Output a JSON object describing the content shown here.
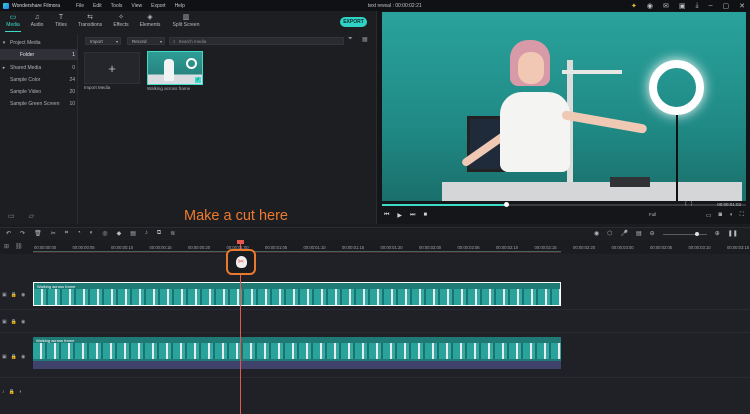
{
  "titlebar": {
    "app_name": "Wondershare Filmora",
    "menu": [
      "File",
      "Edit",
      "Tools",
      "View",
      "Export",
      "Help"
    ],
    "document": "text reveal : 00:00:02:21",
    "icons": [
      "bulb-icon",
      "user-icon",
      "mail-icon",
      "save-icon",
      "download-icon",
      "minimize-icon",
      "maximize-icon",
      "close-icon"
    ]
  },
  "toolbar": {
    "tabs": [
      {
        "label": "Media",
        "icon": "media-icon",
        "active": true
      },
      {
        "label": "Audio",
        "icon": "music-icon",
        "active": false
      },
      {
        "label": "Titles",
        "icon": "titles-icon",
        "active": false
      },
      {
        "label": "Transitions",
        "icon": "transitions-icon",
        "active": false
      },
      {
        "label": "Effects",
        "icon": "effects-icon",
        "active": false
      },
      {
        "label": "Elements",
        "icon": "elements-icon",
        "active": false
      },
      {
        "label": "Split Screen",
        "icon": "split-screen-icon",
        "active": false
      }
    ],
    "export_label": "EXPORT"
  },
  "sidebar": {
    "items": [
      {
        "label": "Project Media",
        "count": "",
        "arrow": "▾"
      },
      {
        "label": "Folder",
        "count": "1",
        "arrow": ""
      },
      {
        "label": "Shared Media",
        "count": "0",
        "arrow": "▸"
      },
      {
        "label": "Sample Color",
        "count": "24",
        "arrow": ""
      },
      {
        "label": "Sample Video",
        "count": "20",
        "arrow": ""
      },
      {
        "label": "Sample Green Screen",
        "count": "10",
        "arrow": ""
      }
    ]
  },
  "media": {
    "import_dropdown": "Import",
    "record_dropdown": "Record",
    "search_placeholder": "Search media",
    "import_tile_label": "Import Media",
    "clip_label": "Walking across frame"
  },
  "preview": {
    "time": "00:00:01:03",
    "zoom": "Full",
    "progress": 0.34
  },
  "ruler": {
    "labels": [
      "00:00:00:00",
      "00:00:00:05",
      "00:00:00:10",
      "00:00:00:15",
      "00:00:00:20",
      "00:00:01:00",
      "00:00:01:05",
      "00:00:01:10",
      "00:00:01:15",
      "00:00:01:20",
      "00:00:02:00",
      "00:00:02:05",
      "00:00:02:10",
      "00:00:02:15",
      "00:00:02:20",
      "00:00:03:00",
      "00:00:03:05",
      "00:00:03:10",
      "00:00:03:15"
    ]
  },
  "timeline": {
    "clip1_label": "Walking across frame",
    "clip2_label": "Walking across frame"
  },
  "annotation": {
    "text": "Make a cut here"
  },
  "colors": {
    "accent": "#2fd2c5",
    "playhead": "#e8564d",
    "annotation": "#f07a2b"
  }
}
